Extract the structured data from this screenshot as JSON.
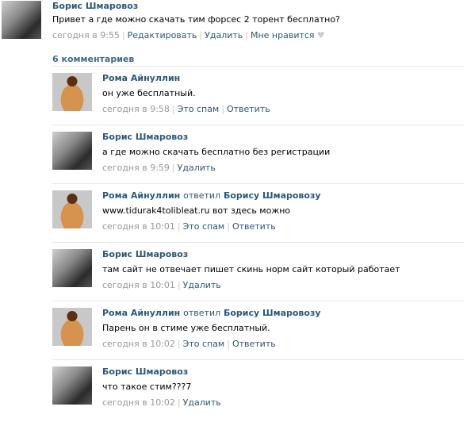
{
  "post": {
    "author": "Борис Шмаровоз",
    "text": "Привет а где можно скачать тим форсес 2 торент бесплатно?",
    "time": "сегодня в 9:55",
    "edit_label": "Редактировать",
    "delete_label": "Удалить",
    "like_label": "Мне нравится",
    "like_icon": "heart-icon"
  },
  "comments_count": "6 комментариев",
  "comments": [
    {
      "author": "Рома Айнуллин",
      "replied": "",
      "reply_to": "",
      "text": "он уже бесплатный.",
      "time": "сегодня в 9:58",
      "action1": "Это спам",
      "action2": "Ответить"
    },
    {
      "author": "Борис Шмаровоз",
      "replied": "",
      "reply_to": "",
      "text": "а где можно скачать бесплатно без регистрации",
      "time": "сегодня в 9:59",
      "action1": "Удалить",
      "action2": ""
    },
    {
      "author": "Рома Айнуллин",
      "replied": "ответил",
      "reply_to": "Борису Шмаровозу",
      "text": "www.tidurak4tolibleat.ru вот здесь можно",
      "time": "сегодня в 10:01",
      "action1": "Это спам",
      "action2": "Ответить"
    },
    {
      "author": "Борис Шмаровоз",
      "replied": "",
      "reply_to": "",
      "text": "там сайт не отвечает пишет скинь норм сайт который работает",
      "time": "сегодня в 10:01",
      "action1": "Удалить",
      "action2": ""
    },
    {
      "author": "Рома Айнуллин",
      "replied": "ответил",
      "reply_to": "Борису Шмаровозу",
      "text": "Парень он в стиме уже бесплатный.",
      "time": "сегодня в 10:02",
      "action1": "Это спам",
      "action2": "Ответить"
    },
    {
      "author": "Борис Шмаровоз",
      "replied": "",
      "reply_to": "",
      "text": "что такое стим???7",
      "time": "сегодня в 10:02",
      "action1": "Удалить",
      "action2": ""
    }
  ]
}
